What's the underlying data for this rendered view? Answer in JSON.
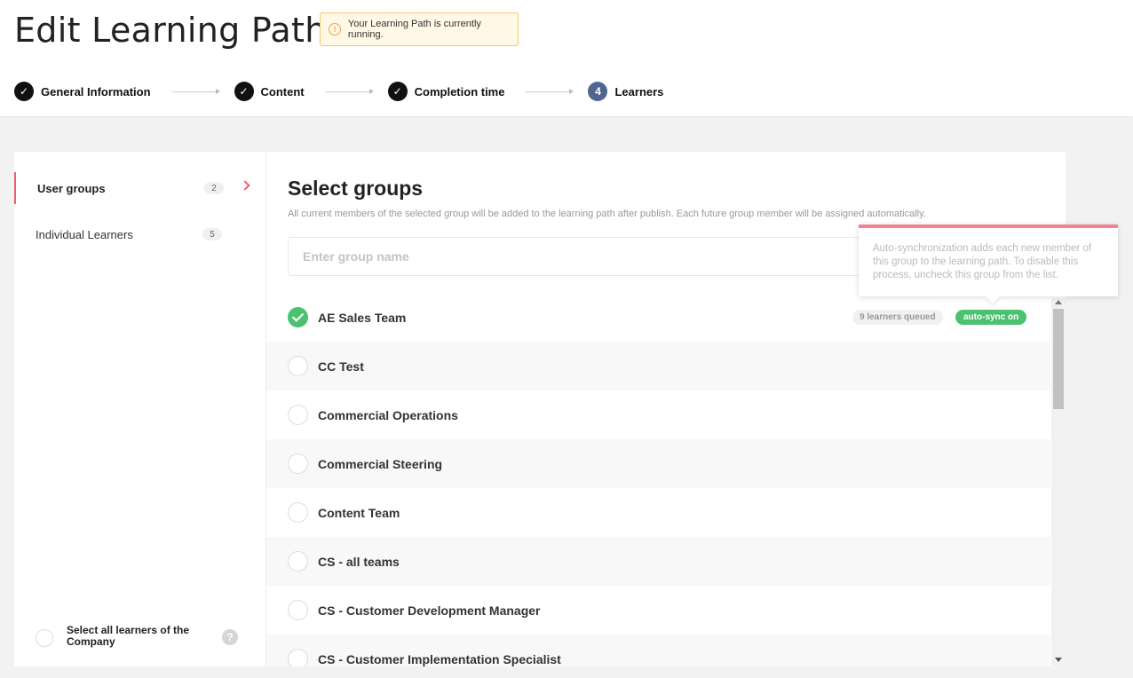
{
  "header": {
    "title": "Edit Learning Path",
    "status_notice": "Your Learning Path is currently running.",
    "status_icon": "info-icon"
  },
  "stepper": {
    "steps": [
      {
        "label": "General Information",
        "state": "done"
      },
      {
        "label": "Content",
        "state": "done"
      },
      {
        "label": "Completion time",
        "state": "done"
      },
      {
        "label": "Learners",
        "state": "current",
        "number": "4"
      }
    ]
  },
  "sidebar": {
    "items": [
      {
        "label": "User groups",
        "count": "2",
        "active": true
      },
      {
        "label": "Individual Learners",
        "count": "5",
        "active": false
      }
    ],
    "select_all_label": "Select all learners of the Company",
    "help_glyph": "?"
  },
  "main": {
    "title": "Select groups",
    "description": "All current members of the selected group will be added to the learning path after publish. Each future group member will be assigned automatically.",
    "search_placeholder": "Enter group name",
    "groups": [
      {
        "name": "AE Sales Team",
        "checked": true,
        "queued": "9 learners queued",
        "sync": "auto-sync on"
      },
      {
        "name": "CC Test",
        "checked": false
      },
      {
        "name": "Commercial Operations",
        "checked": false
      },
      {
        "name": "Commercial Steering",
        "checked": false
      },
      {
        "name": "Content Team",
        "checked": false
      },
      {
        "name": "CS - all teams",
        "checked": false
      },
      {
        "name": "CS - Customer Development Manager",
        "checked": false
      },
      {
        "name": "CS - Customer Implementation Specialist",
        "checked": false
      }
    ]
  },
  "tooltip": {
    "text": "Auto-synchronization adds each new member of this group to the learning path. To disable this process, uncheck this group from the list."
  },
  "colors": {
    "accent": "#ec5e6f",
    "success": "#4cc271",
    "step_current": "#4f6790",
    "warning": "#f3c76a"
  }
}
